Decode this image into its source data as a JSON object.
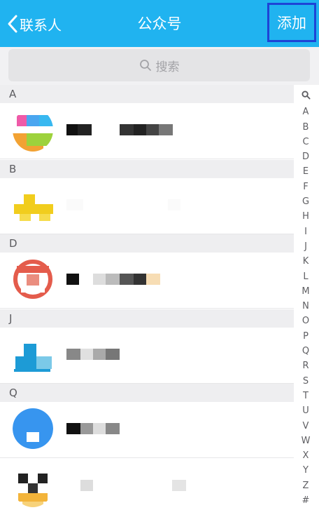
{
  "header": {
    "back_label": "联系人",
    "title": "公众号",
    "add_label": "添加"
  },
  "search": {
    "placeholder": "搜索"
  },
  "sections": [
    {
      "letter": "A"
    },
    {
      "letter": "B"
    },
    {
      "letter": "D"
    },
    {
      "letter": "J"
    },
    {
      "letter": "Q"
    }
  ],
  "index_letters": [
    "A",
    "B",
    "C",
    "D",
    "E",
    "F",
    "G",
    "H",
    "I",
    "J",
    "K",
    "L",
    "M",
    "N",
    "O",
    "P",
    "Q",
    "R",
    "S",
    "T",
    "U",
    "V",
    "W",
    "X",
    "Y",
    "Z",
    "#"
  ],
  "colors": {
    "header": "#20b3f0",
    "highlight": "#1e44d6"
  }
}
